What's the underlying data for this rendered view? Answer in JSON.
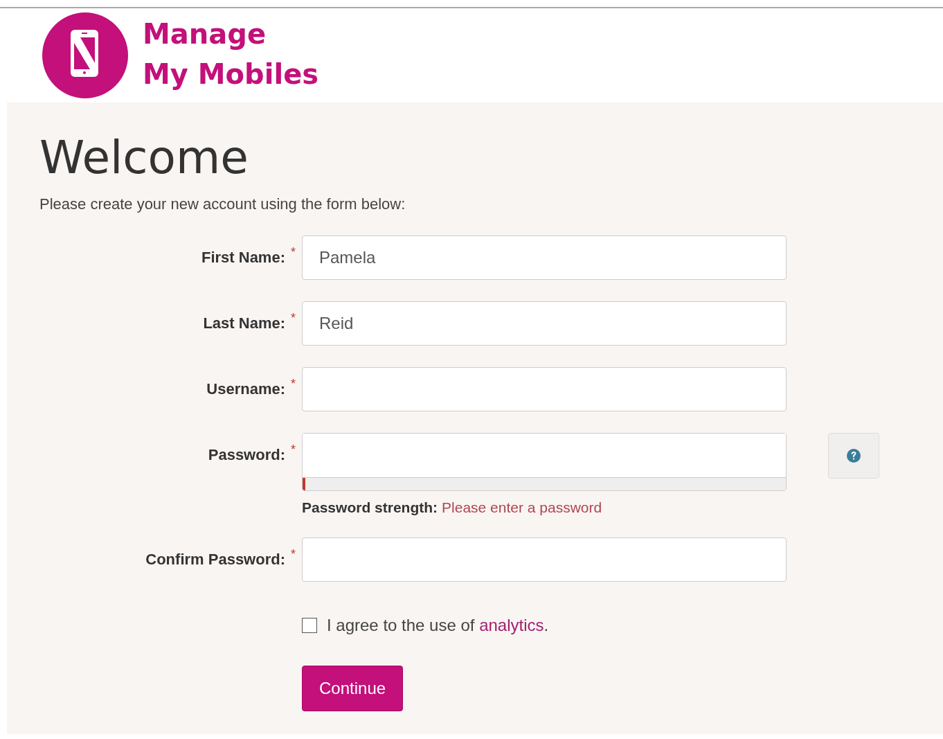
{
  "header": {
    "logo_line_1": "Manage",
    "logo_line_2": "My Mobiles"
  },
  "title": "Welcome",
  "intro": "Please create your new account using the form below:",
  "fields": [
    {
      "kind": "text",
      "label": "First Name:",
      "required": true,
      "value": "Pamela"
    },
    {
      "kind": "text",
      "label": "Last Name:",
      "required": true,
      "value": "Reid"
    },
    {
      "kind": "text",
      "label": "Username:",
      "required": true
    },
    {
      "kind": "password",
      "label": "Password:",
      "required": true,
      "strength": {
        "level": 0.005,
        "label": "Password strength:",
        "message": "Please enter a password"
      }
    },
    {
      "kind": "text",
      "label": "Confirm Password:",
      "required": true
    }
  ],
  "required_mark": "*",
  "agree": {
    "checked": false,
    "text": "I agree to the use of ",
    "link": "analytics",
    "after": "."
  },
  "submit": "Continue"
}
